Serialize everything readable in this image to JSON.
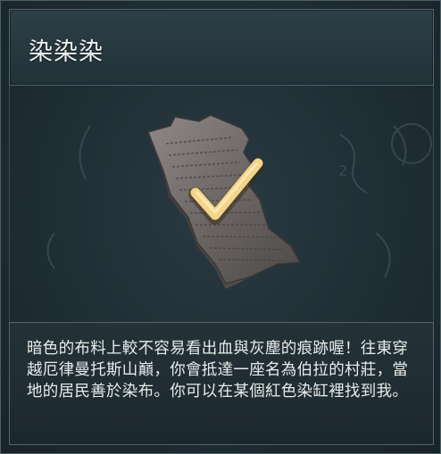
{
  "title": "染染染",
  "item": {
    "icon": "torn-stone-tablet-icon",
    "status_icon": "checkmark-icon",
    "check_color": "#f3d48a"
  },
  "description": "暗色的布料上較不容易看出血與灰塵的痕跡喔！往東穿越厄律曼托斯山巔，你會抵達一座名為伯拉的村莊，當地的居民善於染布。你可以在某個紅色染缸裡找到我。",
  "colors": {
    "panel_bg": "#1f2e35",
    "border": "#52646b",
    "text": "#e7ece9"
  }
}
